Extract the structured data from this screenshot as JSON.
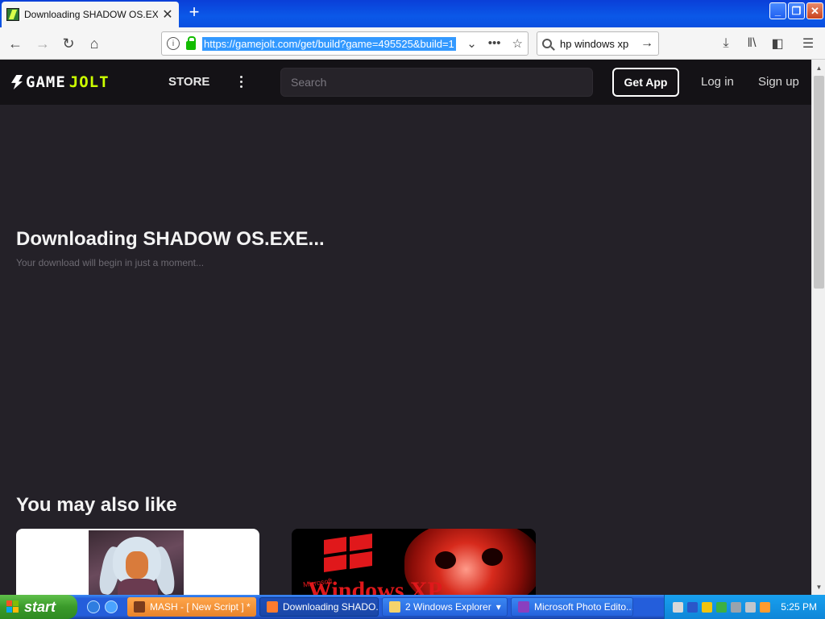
{
  "browser": {
    "tab_title": "Downloading SHADOW OS.EXE - G",
    "url": "https://gamejolt.com/get/build?game=495525&build=1",
    "search_value": "hp windows xp"
  },
  "site": {
    "logo_game": "GAME",
    "logo_jolt": "JOLT",
    "nav_store": "STORE",
    "search_placeholder": "Search",
    "get_app": "Get App",
    "login": "Log in",
    "signup": "Sign up"
  },
  "download": {
    "title": "Downloading SHADOW OS.EXE...",
    "subtitle": "Your download will begin in just a moment..."
  },
  "recommendations": {
    "heading": "You may also like",
    "cards": [
      {
        "art": "white-haired-character-portrait"
      },
      {
        "art": "windows-xp-red-skull",
        "text": "Windows XP",
        "brand": "Microsoft"
      }
    ]
  },
  "taskbar": {
    "start": "start",
    "tasks": [
      {
        "label": "MASH - [ New Script ] *",
        "style": "orange"
      },
      {
        "label": "Downloading SHADO...",
        "style": "active"
      },
      {
        "label": "2 Windows Explorer",
        "style": "blue"
      },
      {
        "label": "Microsoft Photo Edito...",
        "style": "blue"
      }
    ],
    "clock": "5:25 PM"
  },
  "colors": {
    "page_bg": "#242128",
    "header_bg": "#141216",
    "jolt_accent": "#ccff00",
    "url_highlight": "#3399ff"
  }
}
